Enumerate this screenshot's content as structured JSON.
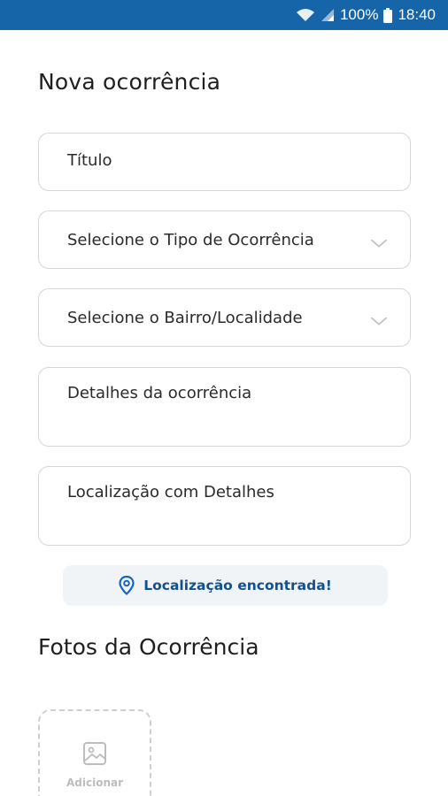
{
  "status_bar": {
    "battery_percent": "100%",
    "time": "18:40",
    "icons": [
      "wifi-icon",
      "signal-icon",
      "battery-icon"
    ]
  },
  "form": {
    "title": "Nova ocorrência",
    "fields": {
      "titulo": {
        "placeholder": "Título"
      },
      "tipo": {
        "placeholder": "Selecione o Tipo de Ocorrência"
      },
      "bairro": {
        "placeholder": "Selecione o Bairro/Localidade"
      },
      "detalhes": {
        "placeholder": "Detalhes da ocorrência"
      },
      "localizacao": {
        "placeholder": "Localização com Detalhes"
      }
    },
    "location_status": {
      "text": "Localização encontrada!",
      "icon": "location-pin-icon"
    }
  },
  "photos": {
    "section_title": "Fotos da Ocorrência",
    "add_label": "Adicionar",
    "add_icon": "image-icon"
  },
  "colors": {
    "status_bar": "#1565a8",
    "accent": "#14508f",
    "chip_background": "#f1f4f7",
    "border": "#d6d6d6"
  }
}
